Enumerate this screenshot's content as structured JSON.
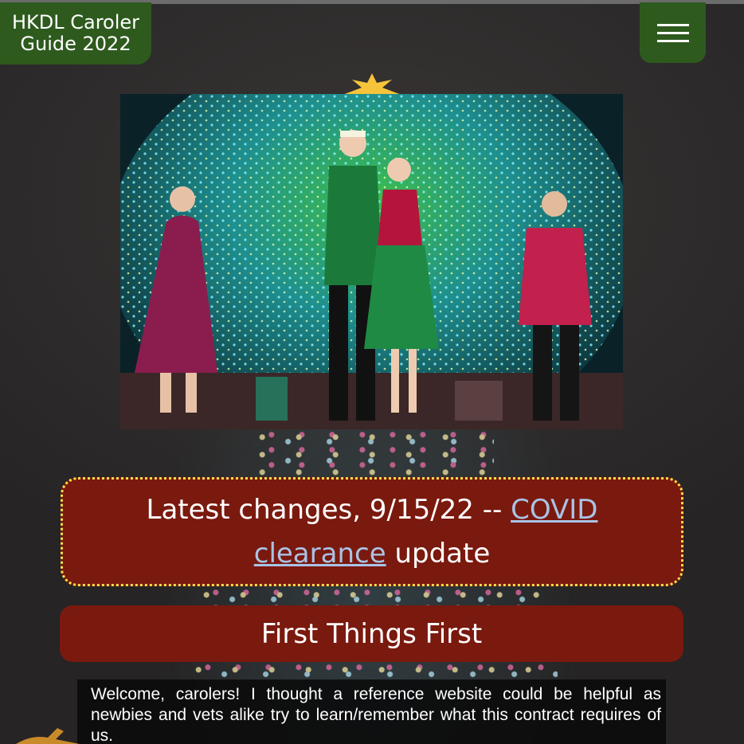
{
  "header": {
    "site_title": "HKDL Caroler Guide 2022",
    "menu_icon": "hamburger-menu-icon"
  },
  "hero": {
    "image_alt": "Four carolers in red and green holiday outfits singing in front of an illuminated Christmas tree",
    "icon": "photo"
  },
  "announcement": {
    "prefix": "Latest changes, 9/15/22 -- ",
    "link_text": "COVID clearance",
    "suffix": "update"
  },
  "sections": {
    "first_heading": "First Things First"
  },
  "welcome": {
    "text": "Welcome, carolers! I thought a reference website could be helpful as newbies and vets alike try to learn/remember what this contract requires of us."
  },
  "colors": {
    "header_green": "#2e5a1e",
    "banner_red": "#7a190e",
    "dotted_border": "#f4e14a",
    "link": "#a9c3e6"
  }
}
